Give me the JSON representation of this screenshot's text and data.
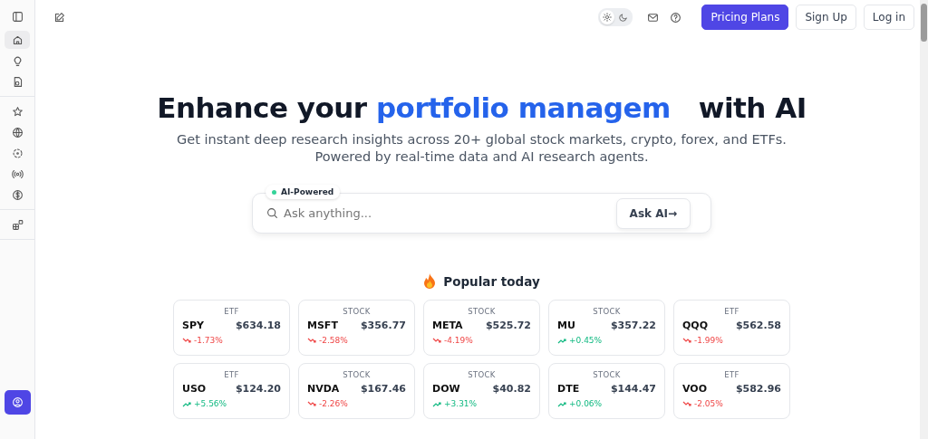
{
  "sidebar": {
    "groups": [
      [
        {
          "selected": true
        },
        {
          "selected": false
        },
        {
          "selected": false
        }
      ],
      [
        {
          "selected": false
        },
        {
          "selected": false
        },
        {
          "selected": false
        },
        {
          "selected": false
        },
        {
          "selected": false
        }
      ],
      [
        {
          "selected": false
        }
      ]
    ]
  },
  "topbar": {
    "theme": [
      {
        "selected": true
      },
      {
        "selected": false
      }
    ],
    "buttons": [
      {
        "label": "Pricing Plans",
        "kind": "primary"
      },
      {
        "label": "Sign Up",
        "kind": "outline"
      },
      {
        "label": "Log in",
        "kind": "outline"
      }
    ]
  },
  "hero": {
    "title_start": "Enhance your ",
    "title_highlight": "portfolio managem",
    "title_end": "with AI",
    "subtitle": [
      "Get instant deep research insights across 20+ global stock markets, crypto, forex, and ETFs.",
      "Powered by real-time data and AI research agents."
    ]
  },
  "search": {
    "badge": "AI-Powered",
    "placeholder": "Ask anything...",
    "button": "Ask AI→"
  },
  "popular": {
    "title": "Popular today",
    "cards": [
      {
        "type": "ETF",
        "symbol": "SPY",
        "price": "$634.18",
        "change": "-1.73%",
        "kind": "down"
      },
      {
        "type": "STOCK",
        "symbol": "MSFT",
        "price": "$356.77",
        "change": "-2.58%",
        "kind": "down"
      },
      {
        "type": "STOCK",
        "symbol": "META",
        "price": "$525.72",
        "change": "-4.19%",
        "kind": "down"
      },
      {
        "type": "STOCK",
        "symbol": "MU",
        "price": "$357.22",
        "change": "+0.45%",
        "kind": "up"
      },
      {
        "type": "ETF",
        "symbol": "QQQ",
        "price": "$562.58",
        "change": "-1.99%",
        "kind": "down"
      },
      {
        "type": "ETF",
        "symbol": "USO",
        "price": "$124.20",
        "change": "+5.56%",
        "kind": "up"
      },
      {
        "type": "STOCK",
        "symbol": "NVDA",
        "price": "$167.46",
        "change": "-2.26%",
        "kind": "down"
      },
      {
        "type": "STOCK",
        "symbol": "DOW",
        "price": "$40.82",
        "change": "+3.31%",
        "kind": "up"
      },
      {
        "type": "STOCK",
        "symbol": "DTE",
        "price": "$144.47",
        "change": "+0.06%",
        "kind": "up"
      },
      {
        "type": "ETF",
        "symbol": "VOO",
        "price": "$582.96",
        "change": "-2.05%",
        "kind": "down"
      }
    ]
  }
}
